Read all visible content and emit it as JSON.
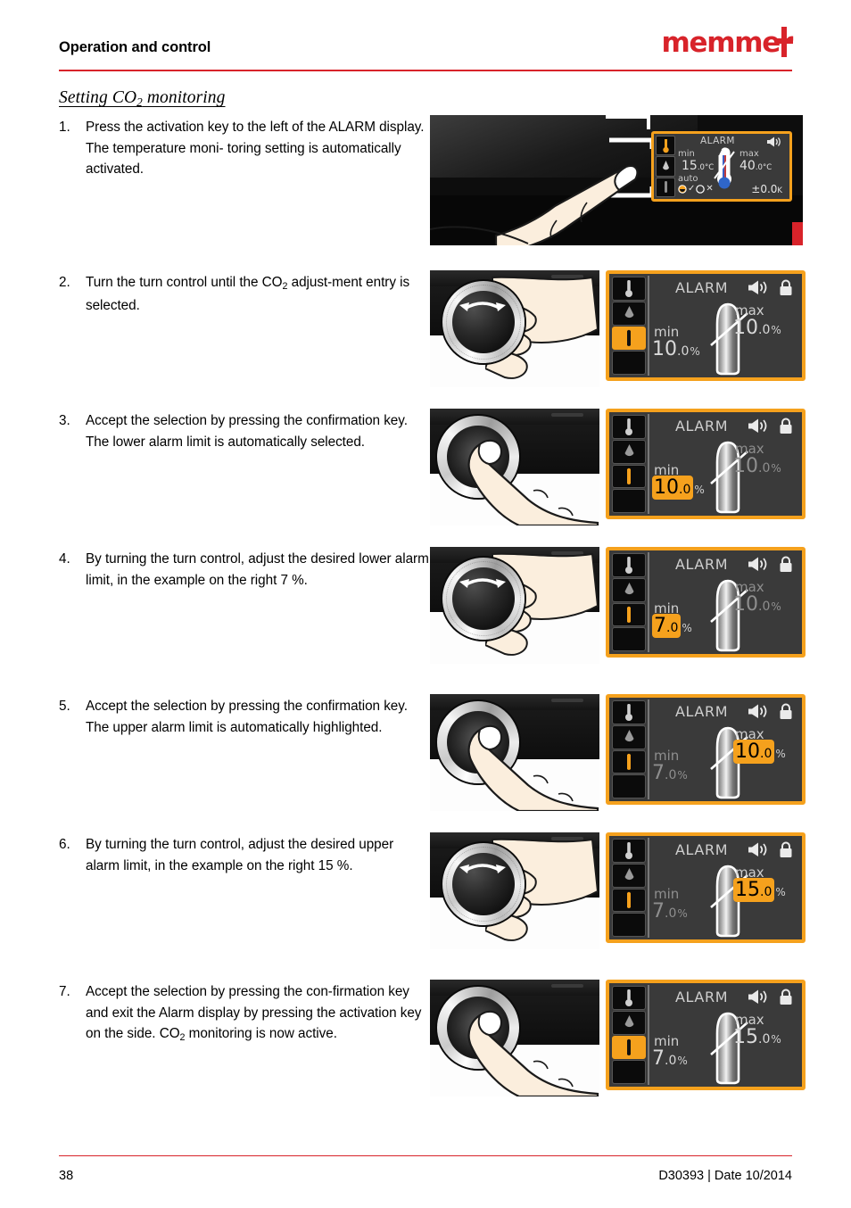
{
  "header": {
    "title": "Operation and control",
    "logo_text": "memmer",
    "logo_color": "#d8232a"
  },
  "section": {
    "title_part1": "Setting CO",
    "title_sub": "2",
    "title_part2": " monitoring"
  },
  "accent_color": "#f5a11d",
  "steps": [
    {
      "num": "1.",
      "text_a": "Press the activation key to the left of the ALARM display. The temperature moni-toring setting is automatically activated.",
      "text": "Press the activation key to the left of the ALARM display. The temperature moni-",
      "text2": "toring setting is automatically activated.",
      "figure": "finger-pressing-activation-key"
    },
    {
      "num": "2.",
      "text_pre": "Turn the turn control until the CO",
      "text_sub": "2",
      "text_post": " adjust-ment entry is selected.",
      "figure": "hand-turning-control-knob"
    },
    {
      "num": "3.",
      "text": "Accept the selection by pressing the confirmation key. The lower alarm limit is automatically selected.",
      "figure": "finger-pressing-confirmation-key"
    },
    {
      "num": "4.",
      "text": "By turning the turn control, adjust the desired lower alarm limit, in the example on the right 7 %.",
      "figure": "hand-turning-control-knob"
    },
    {
      "num": "5.",
      "text": "Accept the selection by pressing the confirmation key. The upper alarm limit is automatically highlighted.",
      "figure": "finger-pressing-confirmation-key"
    },
    {
      "num": "6.",
      "text": "By turning the turn control, adjust the desired upper alarm limit, in the example on the right 15 %.",
      "figure": "hand-turning-control-knob"
    },
    {
      "num": "7.",
      "text_pre": "Accept the selection by pressing the con-firmation key and exit the Alarm display by pressing the activation key on the side. CO",
      "text_sub": "2",
      "text_post": " monitoring is now active.",
      "figure": "finger-pressing-confirmation-key"
    }
  ],
  "temp_display": {
    "title": "ALARM",
    "min_label": "min",
    "min_value": "15",
    "min_decimal": ".0",
    "min_unit": "°C",
    "max_label": "max",
    "max_value": "40",
    "max_decimal": ".0",
    "max_unit": "°C",
    "auto_label": "auto",
    "check_mark": "✓",
    "cross_mark": "✕",
    "tolerance": "±0.0",
    "tolerance_unit": "K",
    "speaker_icon": "speaker-icon",
    "thermometer_icon": "thermometer-icon"
  },
  "displays": [
    {
      "step": "2",
      "title": "ALARM",
      "min_label": "min",
      "min_value": "10",
      "min_decimal": ".0",
      "unit": "%",
      "max_label": "max",
      "max_value": "10",
      "max_decimal": ".0",
      "min_highlighted": false,
      "max_highlighted": false,
      "min_dim": false,
      "max_dim": false,
      "sidebar_active": true
    },
    {
      "step": "3",
      "title": "ALARM",
      "min_label": "min",
      "min_value": "10",
      "min_decimal": ".0",
      "unit": "%",
      "max_label": "max",
      "max_value": "10",
      "max_decimal": ".0",
      "min_highlighted": true,
      "max_highlighted": false,
      "min_dim": false,
      "max_dim": true,
      "sidebar_active": false
    },
    {
      "step": "4",
      "title": "ALARM",
      "min_label": "min",
      "min_value": "7",
      "min_decimal": ".0",
      "unit": "%",
      "max_label": "max",
      "max_value": "10",
      "max_decimal": ".0",
      "min_highlighted": true,
      "max_highlighted": false,
      "min_dim": false,
      "max_dim": true,
      "sidebar_active": false
    },
    {
      "step": "5",
      "title": "ALARM",
      "min_label": "min",
      "min_value": "7",
      "min_decimal": ".0",
      "unit": "%",
      "max_label": "max",
      "max_value": "10",
      "max_decimal": ".0",
      "min_highlighted": false,
      "max_highlighted": true,
      "min_dim": true,
      "max_dim": false,
      "sidebar_active": false
    },
    {
      "step": "6",
      "title": "ALARM",
      "min_label": "min",
      "min_value": "7",
      "min_decimal": ".0",
      "unit": "%",
      "max_label": "max",
      "max_value": "15",
      "max_decimal": ".0",
      "min_highlighted": false,
      "max_highlighted": true,
      "min_dim": true,
      "max_dim": false,
      "sidebar_active": false
    },
    {
      "step": "7",
      "title": "ALARM",
      "min_label": "min",
      "min_value": "7",
      "min_decimal": ".0",
      "unit": "%",
      "max_label": "max",
      "max_value": "15",
      "max_decimal": ".0",
      "min_highlighted": false,
      "max_highlighted": false,
      "min_dim": false,
      "max_dim": false,
      "sidebar_active": true
    }
  ],
  "footer": {
    "page_number": "38",
    "doc_info": "D30393 | Date 10/2014"
  }
}
